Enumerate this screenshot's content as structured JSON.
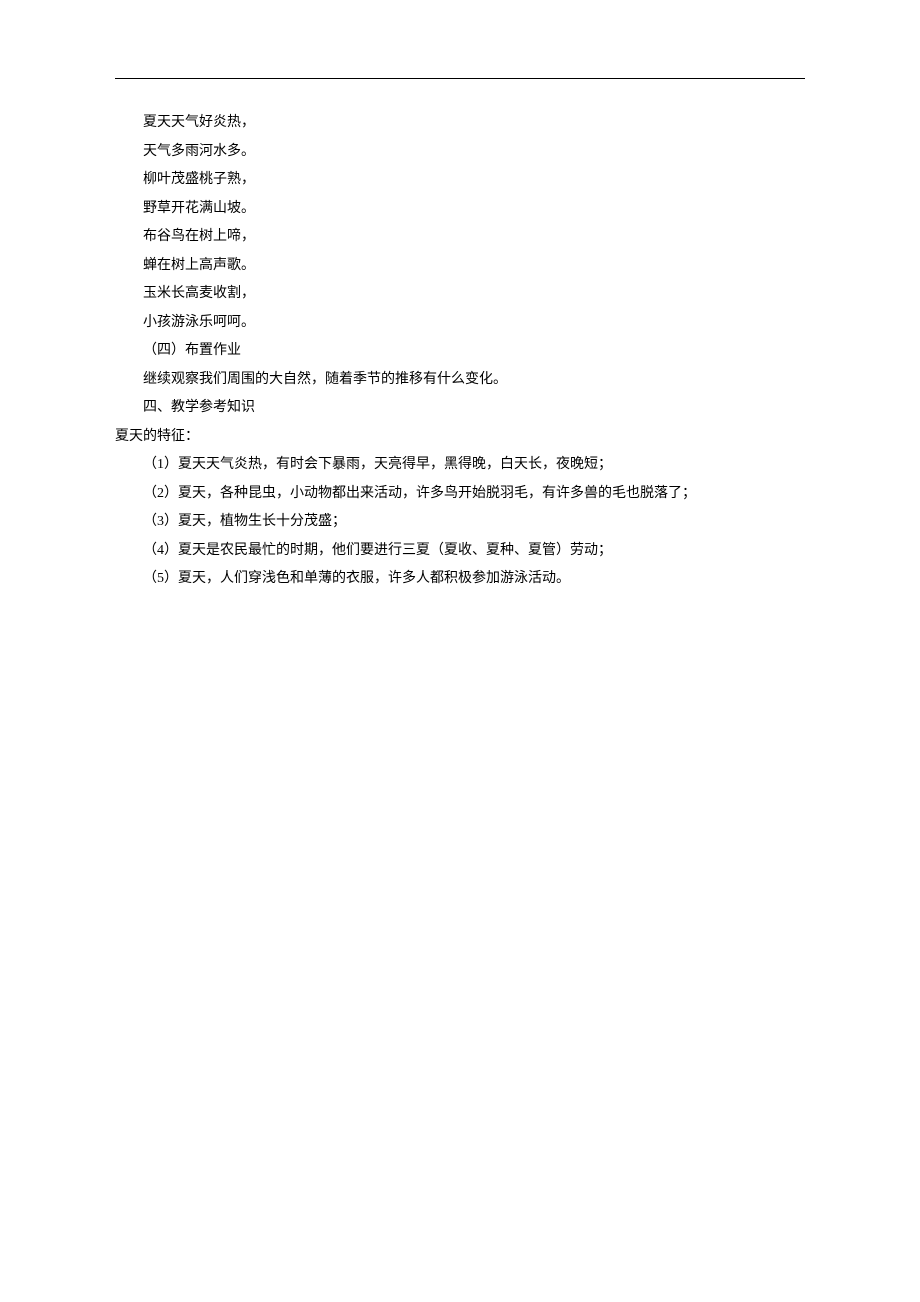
{
  "lines": [
    "夏天天气好炎热，",
    "天气多雨河水多。",
    "柳叶茂盛桃子熟，",
    "野草开花满山坡。",
    "布谷鸟在树上啼，",
    "蝉在树上高声歌。",
    "玉米长高麦收割，",
    "小孩游泳乐呵呵。",
    "（四）布置作业",
    "继续观察我们周围的大自然，随着季节的推移有什么变化。",
    "四、教学参考知识",
    "夏天的特征：",
    "（1）夏天天气炎热，有时会下暴雨，天亮得早，黑得晚，白天长，夜晚短；",
    "（2）夏天，各种昆虫，小动物都出来活动，许多鸟开始脱羽毛，有许多兽的毛也脱落了；",
    "（3）夏天，植物生长十分茂盛；",
    "（4）夏天是农民最忙的时期，他们要进行三夏（夏收、夏种、夏管）劳动；",
    "（5）夏天，人们穿浅色和单薄的衣服，许多人都积极参加游泳活动。"
  ],
  "indent": [
    1,
    1,
    1,
    1,
    1,
    1,
    1,
    1,
    1,
    1,
    1,
    0,
    1,
    1,
    1,
    1,
    1
  ]
}
